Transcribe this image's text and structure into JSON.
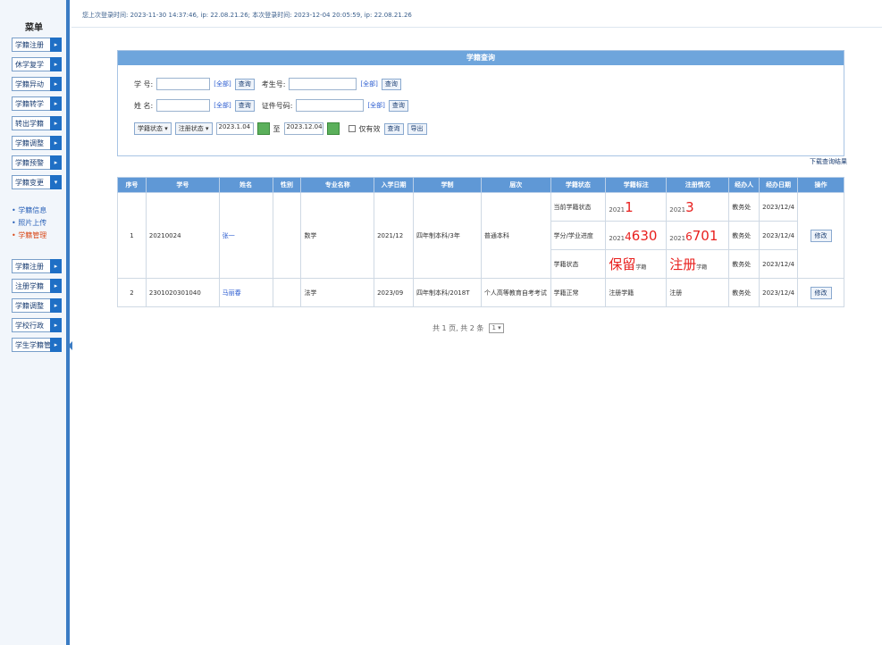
{
  "topline": "您上次登录时间: 2023-11-30 14:37:46, ip: 22.08.21.26; 本次登录时间: 2023-12-04 20:05:59, ip: 22.08.21.26",
  "sidebar": {
    "title": "菜单",
    "buttons_top": [
      "学籍注册",
      "休学复学",
      "学籍异动",
      "学籍转学",
      "转出学籍",
      "学籍调整",
      "学籍预警",
      "学籍变更"
    ],
    "links": [
      "• 学籍信息",
      "• 照片上传",
      "• 学籍管理"
    ],
    "buttons_bottom": [
      "学籍注册",
      "注册学籍",
      "学籍调整",
      "学校行政",
      "学生学籍管理"
    ]
  },
  "query": {
    "title": "学籍查询",
    "row1": {
      "label1": "学 号:",
      "link1": "[全部]",
      "btn1": "查询",
      "label2": "考生号:",
      "link2": "[全部]",
      "btn2": "查询"
    },
    "row2": {
      "label1": "姓 名:",
      "link1": "[全部]",
      "btn1": "查询",
      "label2": "证件号码:",
      "link2": "[全部]",
      "btn2": "查询"
    },
    "row3": {
      "select1": "学籍状态 ▾",
      "select2": "注册状态 ▾",
      "date_from": "2023.1.04",
      "date_sep": "至",
      "date_to": "2023.12.04",
      "check_label": "仅有效",
      "btn_query": "查询",
      "btn_reset": "导出"
    }
  },
  "download_link": "下载查询结果",
  "table": {
    "headers": [
      "序号",
      "学号",
      "姓名",
      "性别",
      "专业名称",
      "入学日期",
      "学制",
      "层次",
      "学籍状态",
      "学籍标注",
      "注册情况",
      "经办人",
      "经办日期",
      "操作"
    ],
    "row1": {
      "idx": "1",
      "student_no": "20210024",
      "name": "张一",
      "gender": "",
      "major": "数学",
      "entry": "2021/12",
      "duration": "四年制本科/3年",
      "level": "普通本科",
      "sub": [
        {
          "status": "当前学籍状态",
          "mark_prefix": "2021",
          "mark_big": "1",
          "reg_prefix": "2021",
          "reg_big": "3",
          "handler": "教务处",
          "date": "2023/12/4"
        },
        {
          "status": "学分/学业进度",
          "mark_prefix": "2021",
          "mark_mid": "4",
          "mark_big": "630",
          "reg_prefix": "2021",
          "reg_mid": "6",
          "reg_big": "701",
          "handler": "教务处",
          "date": "2023/12/4"
        },
        {
          "status": "学籍状态",
          "mark_big": "保留",
          "mark_suffix": "学籍",
          "reg_big": "注册",
          "reg_suffix": "学籍",
          "handler": "教务处",
          "date": "2023/12/4"
        }
      ],
      "op": "修改"
    },
    "row2": {
      "idx": "2",
      "student_no": "2301020301040",
      "name": "马丽春",
      "gender": "",
      "major": "法学",
      "entry": "2023/09",
      "duration": "四年制本科/2018T",
      "level": "个人高等教育自考考试",
      "status": "学籍正常",
      "mark": "注册学籍",
      "reg": "注册",
      "handler": "教务处",
      "date": "2023/12/4",
      "op": "修改"
    }
  },
  "pager": {
    "text": "共 1 页, 共 2 条",
    "select": "1 ▾"
  },
  "colors": {
    "sidebar_blue": "#3b7cc4",
    "header_blue": "#5f98d6",
    "panel_blue": "#6ea5dc",
    "red": "#e8201e"
  }
}
